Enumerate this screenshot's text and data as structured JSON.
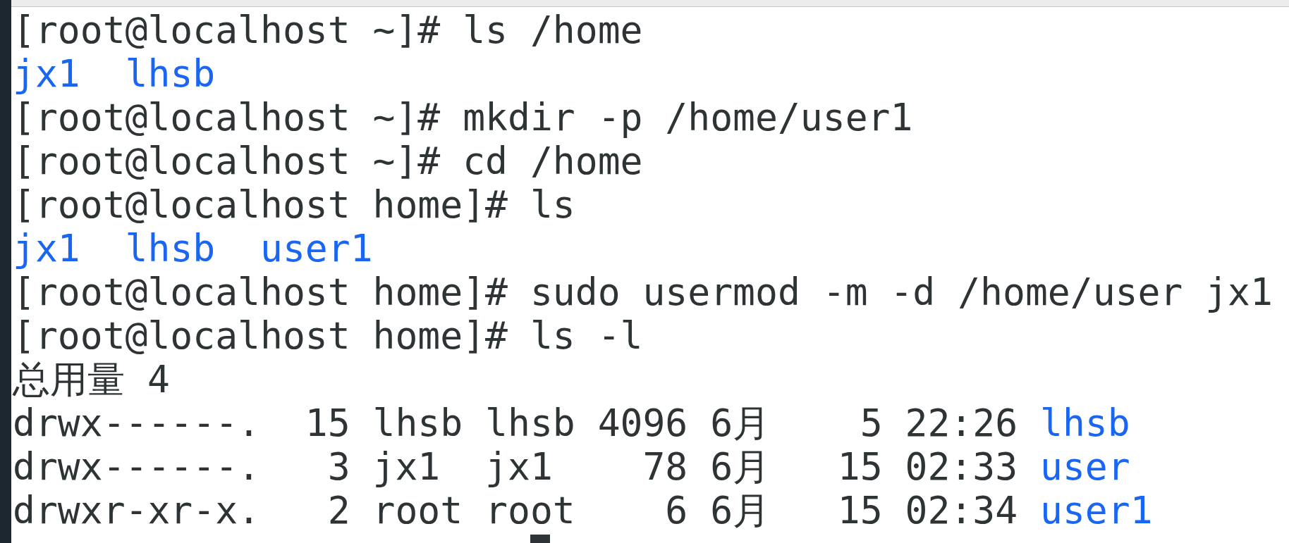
{
  "lines": [
    {
      "kind": "prompt",
      "prompt": "[root@localhost ~]#",
      "command": "ls /home"
    },
    {
      "kind": "entries",
      "entries": [
        "jx1",
        "lhsb"
      ]
    },
    {
      "kind": "prompt",
      "prompt": "[root@localhost ~]#",
      "command": "mkdir -p /home/user1"
    },
    {
      "kind": "prompt",
      "prompt": "[root@localhost ~]#",
      "command": "cd /home"
    },
    {
      "kind": "prompt",
      "prompt": "[root@localhost home]#",
      "command": "ls"
    },
    {
      "kind": "entries",
      "entries": [
        "jx1",
        "lhsb",
        "user1"
      ]
    },
    {
      "kind": "prompt",
      "prompt": "[root@localhost home]#",
      "command": "sudo usermod -m -d /home/user jx1"
    },
    {
      "kind": "prompt",
      "prompt": "[root@localhost home]#",
      "command": "ls -l"
    },
    {
      "kind": "text",
      "text": "总用量 4"
    },
    {
      "kind": "listing",
      "details": "drwx------.  15 lhsb lhsb 4096 6月    5 22:26",
      "name": "lhsb"
    },
    {
      "kind": "listing",
      "details": "drwx------.   3 jx1  jx1    78 6月   15 02:33",
      "name": "user"
    },
    {
      "kind": "listing",
      "details": "drwxr-xr-x.   2 root root    6 6月   15 02:34",
      "name": "user1"
    },
    {
      "kind": "cursor"
    }
  ]
}
